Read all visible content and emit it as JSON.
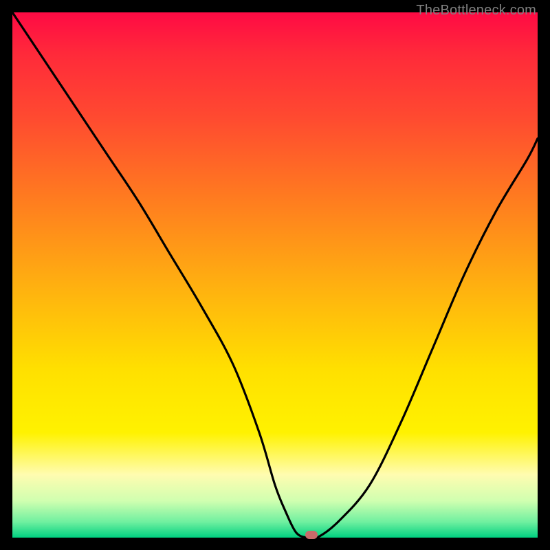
{
  "watermark": "TheBottleneck.com",
  "chart_data": {
    "type": "line",
    "title": "",
    "xlabel": "",
    "ylabel": "",
    "xlim": [
      0,
      100
    ],
    "ylim": [
      0,
      100
    ],
    "grid": false,
    "legend": false,
    "series": [
      {
        "name": "curve",
        "x": [
          0,
          6,
          12,
          18,
          24,
          30,
          36,
          42,
          47,
          50,
          52,
          54,
          56,
          58,
          62,
          68,
          74,
          80,
          86,
          92,
          98,
          100
        ],
        "values": [
          100,
          91,
          82,
          73,
          64,
          54,
          44,
          33,
          20,
          10,
          5,
          1,
          0,
          0,
          3,
          10,
          22,
          36,
          50,
          62,
          72,
          76
        ]
      }
    ],
    "marker": {
      "x": 57,
      "y": 0,
      "color": "#c96a6a"
    },
    "gradient_stops": [
      {
        "pos": 0,
        "color": "#ff0a44"
      },
      {
        "pos": 8,
        "color": "#ff2a3a"
      },
      {
        "pos": 20,
        "color": "#ff4a30"
      },
      {
        "pos": 35,
        "color": "#ff7a20"
      },
      {
        "pos": 52,
        "color": "#ffb010"
      },
      {
        "pos": 68,
        "color": "#ffe000"
      },
      {
        "pos": 80,
        "color": "#fff200"
      },
      {
        "pos": 88,
        "color": "#fffcb0"
      },
      {
        "pos": 93,
        "color": "#d0ffb0"
      },
      {
        "pos": 97,
        "color": "#70f0a0"
      },
      {
        "pos": 100,
        "color": "#00d080"
      }
    ]
  }
}
